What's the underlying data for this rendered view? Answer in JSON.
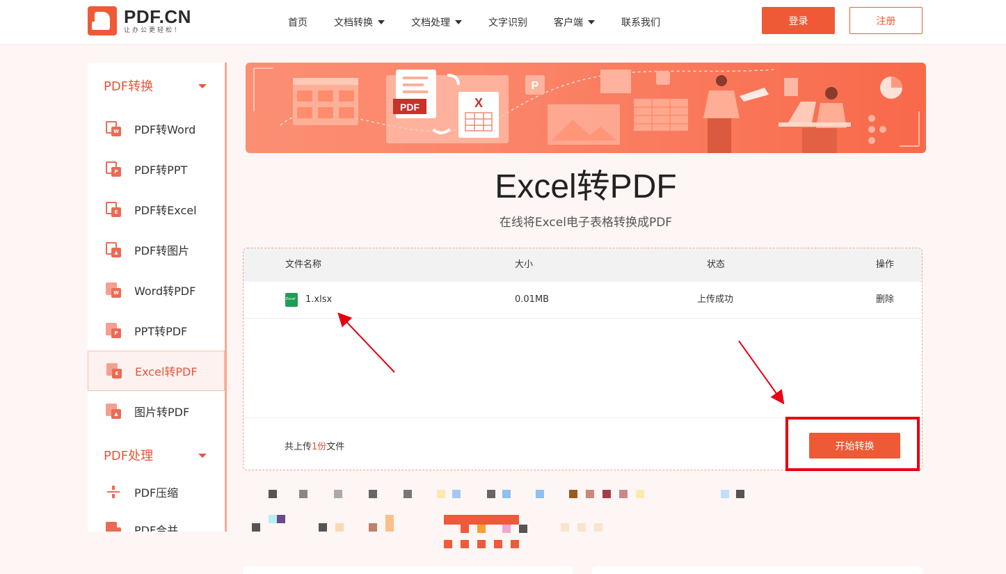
{
  "header": {
    "logo_title": "PDF.CN",
    "logo_slogan": "让办公更轻松！",
    "nav": [
      {
        "label": "首页",
        "has_dropdown": false
      },
      {
        "label": "文档转换",
        "has_dropdown": true
      },
      {
        "label": "文档处理",
        "has_dropdown": true
      },
      {
        "label": "文字识别",
        "has_dropdown": false
      },
      {
        "label": "客户端",
        "has_dropdown": true
      },
      {
        "label": "联系我们",
        "has_dropdown": false
      }
    ],
    "login_label": "登录",
    "register_label": "注册"
  },
  "sidebar": {
    "group1": "PDF转换",
    "items": [
      {
        "label": "PDF转Word",
        "badge": "W"
      },
      {
        "label": "PDF转PPT",
        "badge": "P"
      },
      {
        "label": "PDF转Excel",
        "badge": "E"
      },
      {
        "label": "PDF转图片",
        "badge": "▲"
      },
      {
        "label": "Word转PDF",
        "badge": "W"
      },
      {
        "label": "PPT转PDF",
        "badge": "P"
      },
      {
        "label": "Excel转PDF",
        "badge": "E",
        "active": true
      },
      {
        "label": "图片转PDF",
        "badge": "▲"
      }
    ],
    "group2": "PDF处理",
    "items2": [
      {
        "label": "PDF压缩"
      },
      {
        "label": "PDF合并"
      }
    ]
  },
  "banner": {
    "pdf_label": "PDF",
    "x_label": "X",
    "p_label": "P"
  },
  "main": {
    "title": "Excel转PDF",
    "subtitle": "在线将Excel电子表格转换成PDF"
  },
  "table": {
    "columns": [
      "文件名称",
      "大小",
      "状态",
      "操作"
    ],
    "rows": [
      {
        "name": "1.xlsx",
        "size": "0.01MB",
        "status": "上传成功",
        "action": "删除"
      }
    ],
    "footer_prefix": "共上传",
    "footer_count": "1份",
    "footer_suffix": "文件",
    "start_label": "开始转换"
  },
  "colors": {
    "accent": "#ee5a36",
    "annotation": "#e60012"
  }
}
